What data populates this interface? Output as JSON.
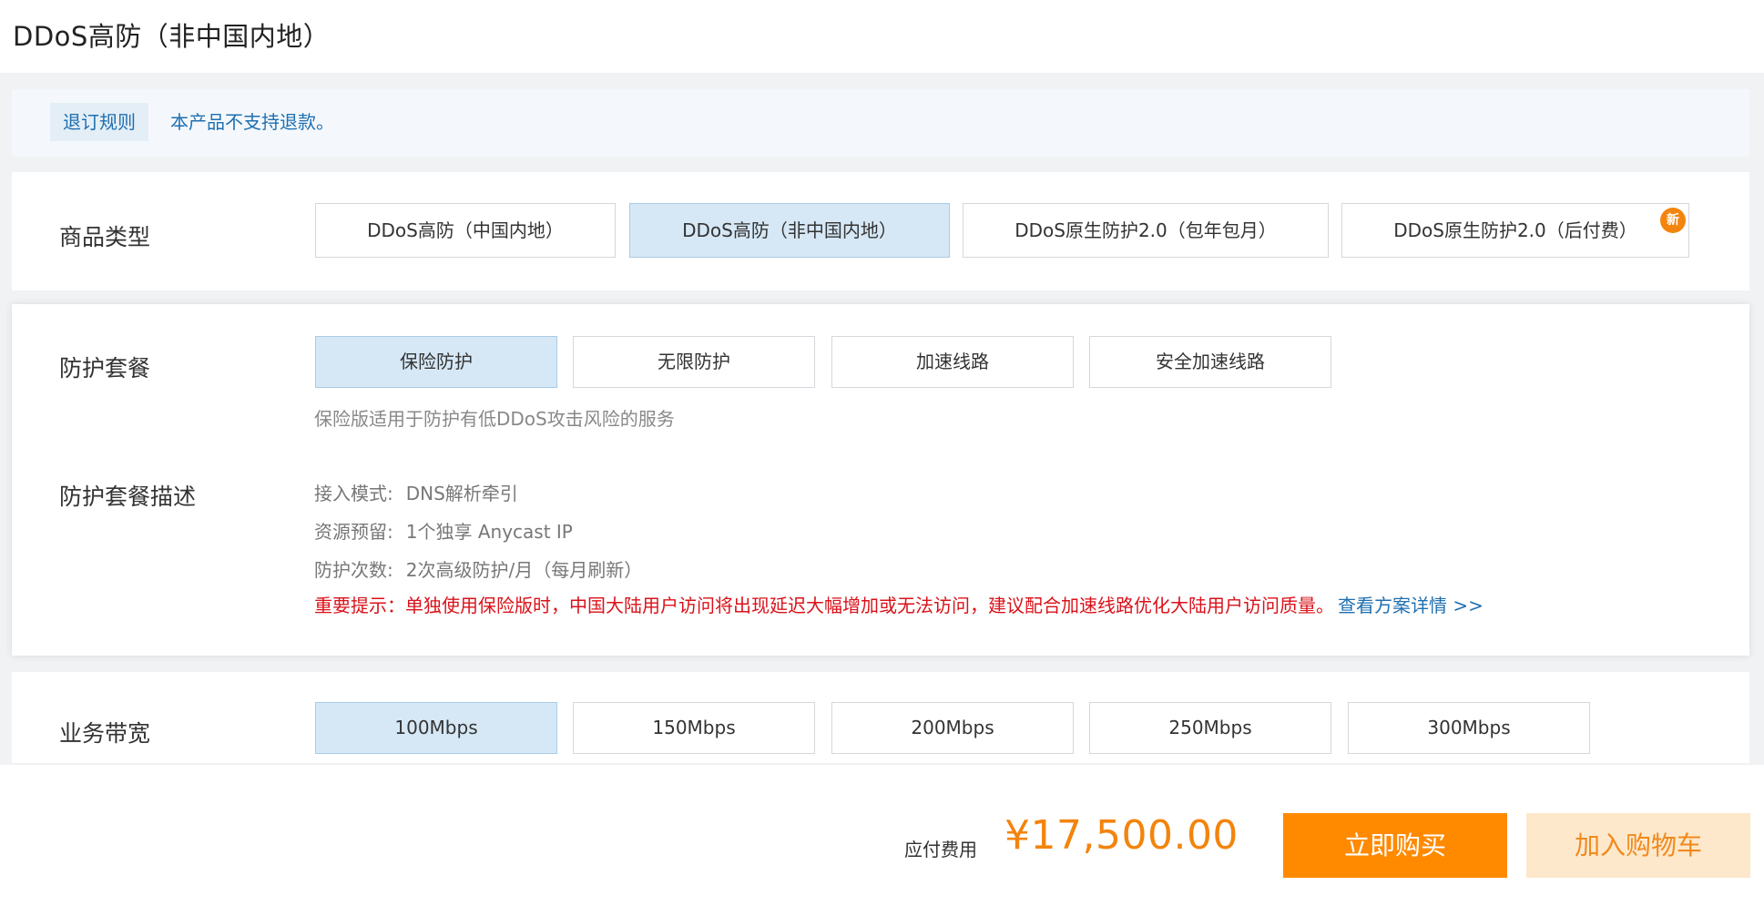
{
  "page": {
    "title": "DDoS高防（非中国内地）"
  },
  "notice": {
    "tag": "退订规则",
    "text": "本产品不支持退款。"
  },
  "product_type": {
    "label": "商品类型",
    "options": [
      {
        "label": "DDoS高防（中国内地）",
        "selected": false
      },
      {
        "label": "DDoS高防（非中国内地）",
        "selected": true
      },
      {
        "label": "DDoS原生防护2.0（包年包月）",
        "selected": false
      },
      {
        "label": "DDoS原生防护2.0（后付费）",
        "selected": false,
        "badge": "新"
      }
    ]
  },
  "plan": {
    "label": "防护套餐",
    "options": [
      {
        "label": "保险防护",
        "selected": true
      },
      {
        "label": "无限防护",
        "selected": false
      },
      {
        "label": "加速线路",
        "selected": false
      },
      {
        "label": "安全加速线路",
        "selected": false
      }
    ],
    "hint": "保险版适用于防护有低DDoS攻击风险的服务"
  },
  "plan_desc": {
    "label": "防护套餐描述",
    "items": [
      {
        "key": "接入模式:",
        "value": "DNS解析牵引"
      },
      {
        "key": "资源预留:",
        "value": "1个独享 Anycast IP"
      },
      {
        "key": "防护次数:",
        "value": "2次高级防护/月（每月刷新）"
      }
    ],
    "warning": "重要提示：单独使用保险版时，中国大陆用户访问将出现延迟大幅增加或无法访问，建议配合加速线路优化大陆用户访问质量。",
    "warning_link": "查看方案详情 >>"
  },
  "bandwidth": {
    "label": "业务带宽",
    "options": [
      {
        "label": "100Mbps",
        "selected": true
      },
      {
        "label": "150Mbps",
        "selected": false
      },
      {
        "label": "200Mbps",
        "selected": false
      },
      {
        "label": "250Mbps",
        "selected": false
      },
      {
        "label": "300Mbps",
        "selected": false
      }
    ]
  },
  "footer": {
    "fee_label": "应付费用",
    "fee_value": "¥17,500.00",
    "buy_label": "立即购买",
    "cart_label": "加入购物车"
  },
  "colors": {
    "accent": "#ff8a00",
    "link": "#1f6fb0",
    "warning": "#d9121a",
    "selected_bg": "#d6e8f6"
  }
}
